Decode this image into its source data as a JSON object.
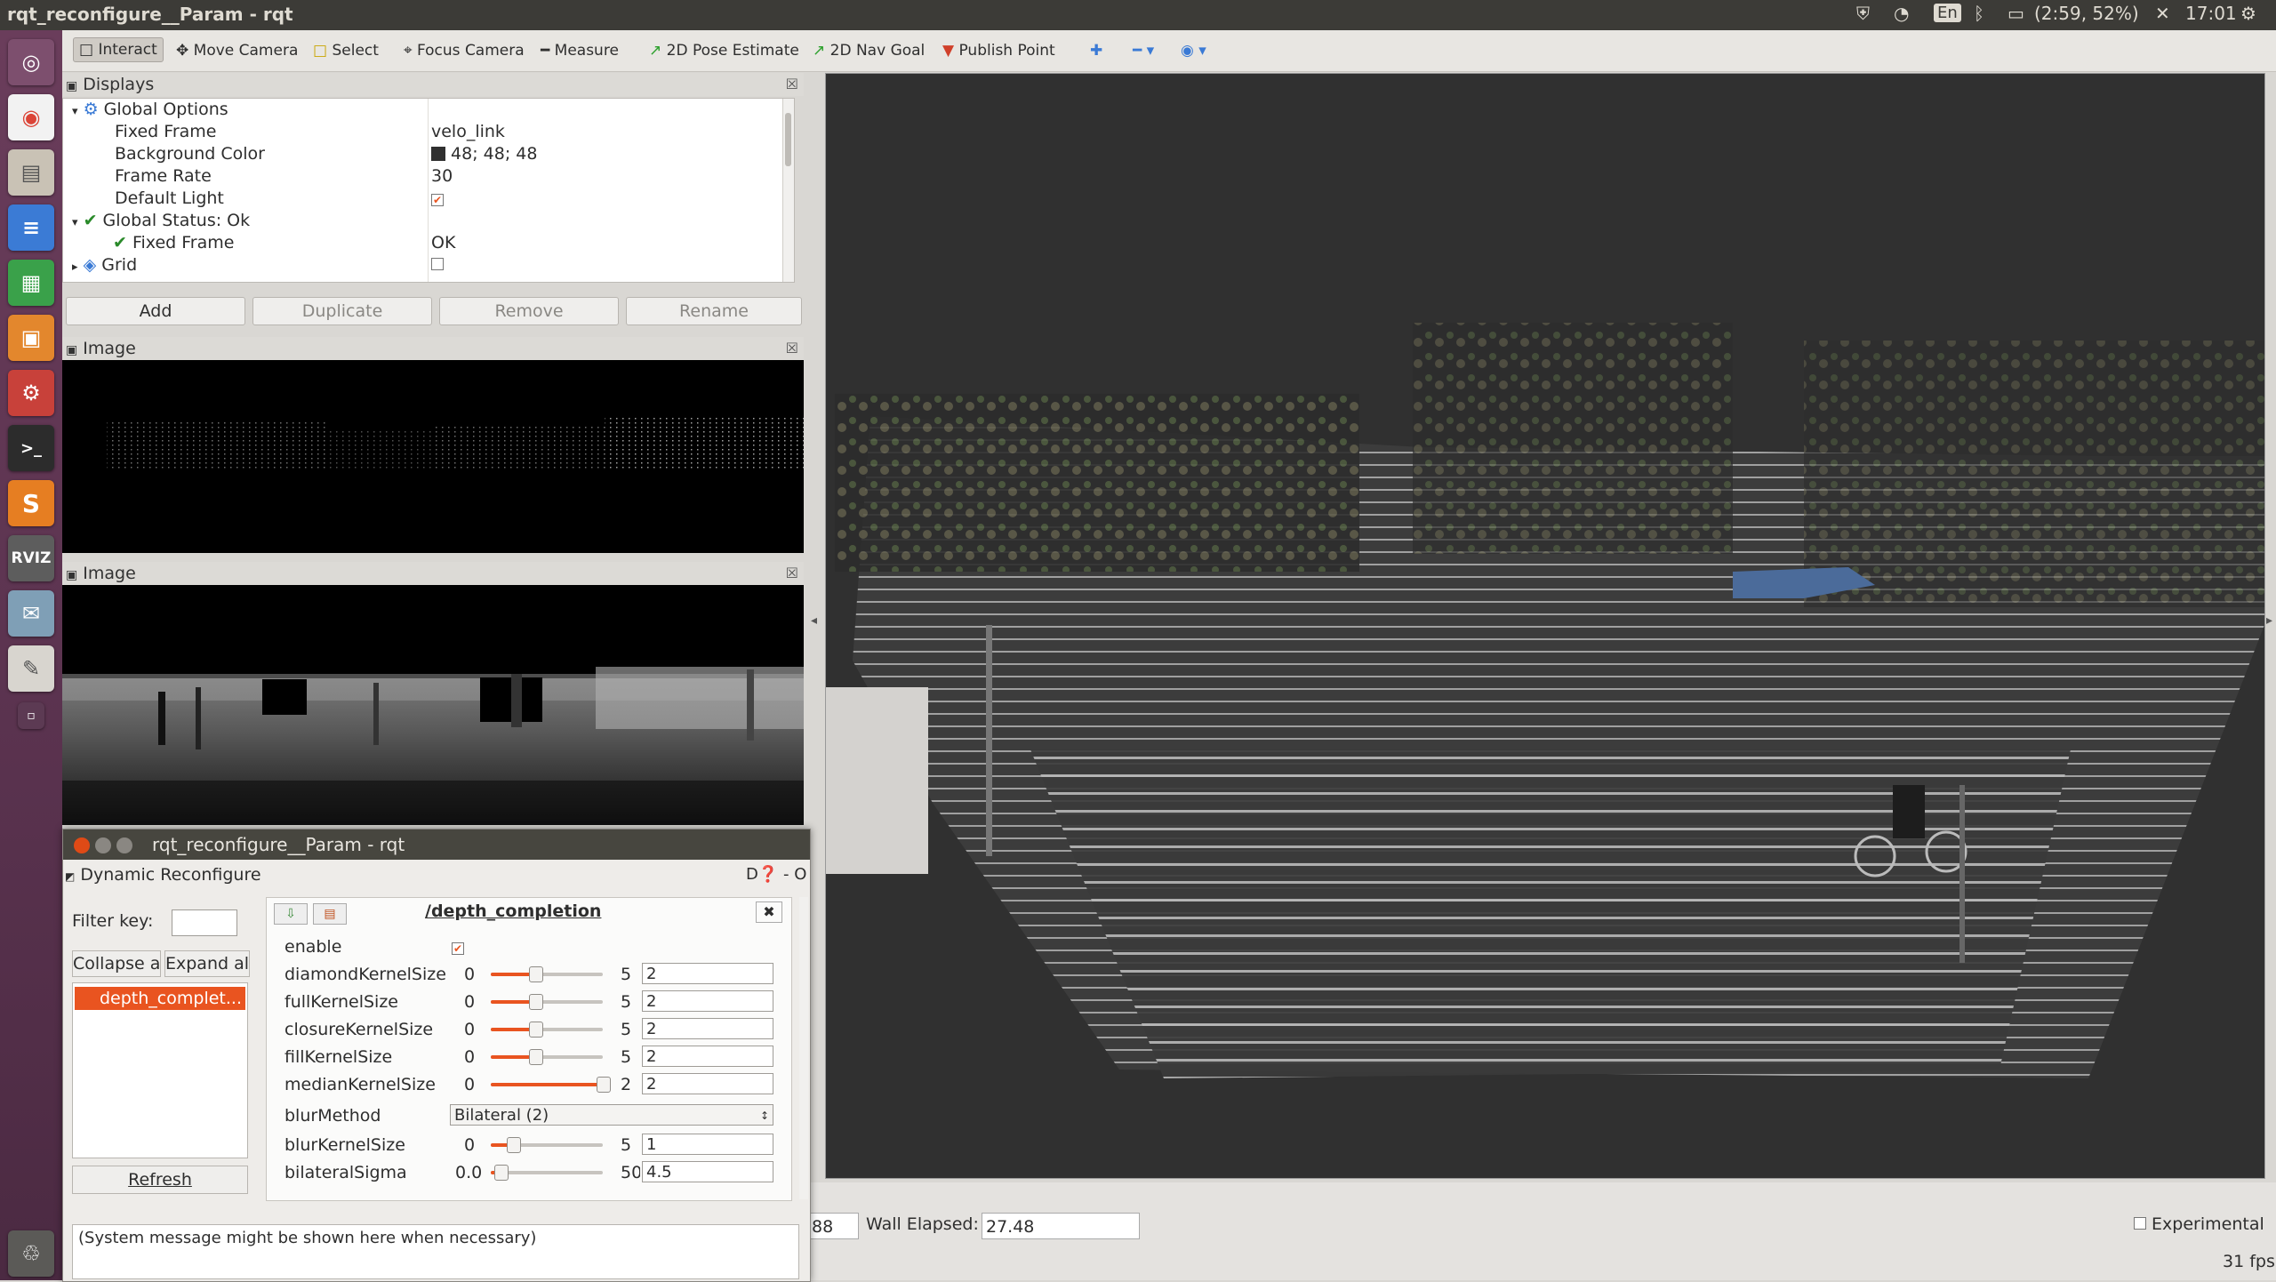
{
  "window": {
    "title": "rqt_reconfigure__Param - rqt"
  },
  "system_tray": {
    "keyboard": "En",
    "battery": "(2:59, 52%)",
    "time": "17:01"
  },
  "toolbar": {
    "interact": "Interact",
    "move_camera": "Move Camera",
    "select": "Select",
    "focus_camera": "Focus Camera",
    "measure": "Measure",
    "pose_estimate": "2D Pose Estimate",
    "nav_goal": "2D Nav Goal",
    "publish_point": "Publish Point"
  },
  "displays": {
    "title": "Displays",
    "global_options": "Global Options",
    "fixed_frame_label": "Fixed Frame",
    "fixed_frame_value": "velo_link",
    "bg_color_label": "Background Color",
    "bg_color_value": "48; 48; 48",
    "frame_rate_label": "Frame Rate",
    "frame_rate_value": "30",
    "default_light_label": "Default Light",
    "global_status": "Global Status: Ok",
    "status_fixed_frame": "Fixed Frame",
    "status_ok": "OK",
    "grid": "Grid",
    "buttons": {
      "add": "Add",
      "duplicate": "Duplicate",
      "remove": "Remove",
      "rename": "Rename"
    }
  },
  "image_panels": {
    "image1": "Image",
    "image2": "Image"
  },
  "reconfigure": {
    "title": "rqt_reconfigure__Param - rqt",
    "plugin_title": "Dynamic Reconfigure",
    "plugin_corner": "D",
    "filter_label": "Filter key:",
    "collapse_all": "Collapse all",
    "expand_all": "Expand all",
    "node_item": "depth_complet...",
    "refresh": "Refresh",
    "node_title": "/depth_completion",
    "enable_label": "enable",
    "params": [
      {
        "name": "diamondKernelSize",
        "min": "0",
        "max": "5",
        "value": "2",
        "frac": 0.4
      },
      {
        "name": "fullKernelSize",
        "min": "0",
        "max": "5",
        "value": "2",
        "frac": 0.4
      },
      {
        "name": "closureKernelSize",
        "min": "0",
        "max": "5",
        "value": "2",
        "frac": 0.4
      },
      {
        "name": "fillKernelSize",
        "min": "0",
        "max": "5",
        "value": "2",
        "frac": 0.4
      },
      {
        "name": "medianKernelSize",
        "min": "0",
        "max": "2",
        "value": "2",
        "frac": 1.0
      }
    ],
    "blur_method_label": "blurMethod",
    "blur_method_value": "Bilateral (2)",
    "blur_kernel": {
      "name": "blurKernelSize",
      "min": "0",
      "max": "5",
      "value": "1",
      "frac": 0.2
    },
    "bilateral_sigma": {
      "name": "bilateralSigma",
      "min": "0.0",
      "max": "50.0",
      "value": "4.5",
      "frac": 0.09
    },
    "status_message": "(System message might be shown here when necessary)"
  },
  "time_panel": {
    "ros_elapsed_fragment": "88",
    "wall_elapsed_label": "Wall Elapsed:",
    "wall_elapsed_value": "27.48",
    "experimental": "Experimental",
    "fps": "31 fps"
  }
}
